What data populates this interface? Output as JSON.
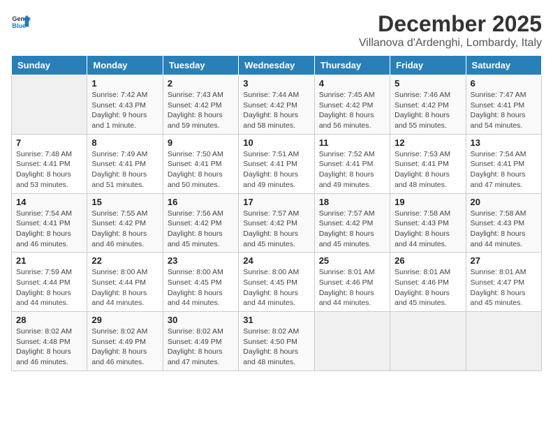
{
  "header": {
    "logo_line1": "General",
    "logo_line2": "Blue",
    "title": "December 2025",
    "subtitle": "Villanova d'Ardenghi, Lombardy, Italy"
  },
  "days_of_week": [
    "Sunday",
    "Monday",
    "Tuesday",
    "Wednesday",
    "Thursday",
    "Friday",
    "Saturday"
  ],
  "weeks": [
    [
      {
        "day": "",
        "info": ""
      },
      {
        "day": "1",
        "info": "Sunrise: 7:42 AM\nSunset: 4:43 PM\nDaylight: 9 hours\nand 1 minute."
      },
      {
        "day": "2",
        "info": "Sunrise: 7:43 AM\nSunset: 4:42 PM\nDaylight: 8 hours\nand 59 minutes."
      },
      {
        "day": "3",
        "info": "Sunrise: 7:44 AM\nSunset: 4:42 PM\nDaylight: 8 hours\nand 58 minutes."
      },
      {
        "day": "4",
        "info": "Sunrise: 7:45 AM\nSunset: 4:42 PM\nDaylight: 8 hours\nand 56 minutes."
      },
      {
        "day": "5",
        "info": "Sunrise: 7:46 AM\nSunset: 4:42 PM\nDaylight: 8 hours\nand 55 minutes."
      },
      {
        "day": "6",
        "info": "Sunrise: 7:47 AM\nSunset: 4:41 PM\nDaylight: 8 hours\nand 54 minutes."
      }
    ],
    [
      {
        "day": "7",
        "info": "Sunrise: 7:48 AM\nSunset: 4:41 PM\nDaylight: 8 hours\nand 53 minutes."
      },
      {
        "day": "8",
        "info": "Sunrise: 7:49 AM\nSunset: 4:41 PM\nDaylight: 8 hours\nand 51 minutes."
      },
      {
        "day": "9",
        "info": "Sunrise: 7:50 AM\nSunset: 4:41 PM\nDaylight: 8 hours\nand 50 minutes."
      },
      {
        "day": "10",
        "info": "Sunrise: 7:51 AM\nSunset: 4:41 PM\nDaylight: 8 hours\nand 49 minutes."
      },
      {
        "day": "11",
        "info": "Sunrise: 7:52 AM\nSunset: 4:41 PM\nDaylight: 8 hours\nand 49 minutes."
      },
      {
        "day": "12",
        "info": "Sunrise: 7:53 AM\nSunset: 4:41 PM\nDaylight: 8 hours\nand 48 minutes."
      },
      {
        "day": "13",
        "info": "Sunrise: 7:54 AM\nSunset: 4:41 PM\nDaylight: 8 hours\nand 47 minutes."
      }
    ],
    [
      {
        "day": "14",
        "info": "Sunrise: 7:54 AM\nSunset: 4:41 PM\nDaylight: 8 hours\nand 46 minutes."
      },
      {
        "day": "15",
        "info": "Sunrise: 7:55 AM\nSunset: 4:42 PM\nDaylight: 8 hours\nand 46 minutes."
      },
      {
        "day": "16",
        "info": "Sunrise: 7:56 AM\nSunset: 4:42 PM\nDaylight: 8 hours\nand 45 minutes."
      },
      {
        "day": "17",
        "info": "Sunrise: 7:57 AM\nSunset: 4:42 PM\nDaylight: 8 hours\nand 45 minutes."
      },
      {
        "day": "18",
        "info": "Sunrise: 7:57 AM\nSunset: 4:42 PM\nDaylight: 8 hours\nand 45 minutes."
      },
      {
        "day": "19",
        "info": "Sunrise: 7:58 AM\nSunset: 4:43 PM\nDaylight: 8 hours\nand 44 minutes."
      },
      {
        "day": "20",
        "info": "Sunrise: 7:58 AM\nSunset: 4:43 PM\nDaylight: 8 hours\nand 44 minutes."
      }
    ],
    [
      {
        "day": "21",
        "info": "Sunrise: 7:59 AM\nSunset: 4:44 PM\nDaylight: 8 hours\nand 44 minutes."
      },
      {
        "day": "22",
        "info": "Sunrise: 8:00 AM\nSunset: 4:44 PM\nDaylight: 8 hours\nand 44 minutes."
      },
      {
        "day": "23",
        "info": "Sunrise: 8:00 AM\nSunset: 4:45 PM\nDaylight: 8 hours\nand 44 minutes."
      },
      {
        "day": "24",
        "info": "Sunrise: 8:00 AM\nSunset: 4:45 PM\nDaylight: 8 hours\nand 44 minutes."
      },
      {
        "day": "25",
        "info": "Sunrise: 8:01 AM\nSunset: 4:46 PM\nDaylight: 8 hours\nand 44 minutes."
      },
      {
        "day": "26",
        "info": "Sunrise: 8:01 AM\nSunset: 4:46 PM\nDaylight: 8 hours\nand 45 minutes."
      },
      {
        "day": "27",
        "info": "Sunrise: 8:01 AM\nSunset: 4:47 PM\nDaylight: 8 hours\nand 45 minutes."
      }
    ],
    [
      {
        "day": "28",
        "info": "Sunrise: 8:02 AM\nSunset: 4:48 PM\nDaylight: 8 hours\nand 46 minutes."
      },
      {
        "day": "29",
        "info": "Sunrise: 8:02 AM\nSunset: 4:49 PM\nDaylight: 8 hours\nand 46 minutes."
      },
      {
        "day": "30",
        "info": "Sunrise: 8:02 AM\nSunset: 4:49 PM\nDaylight: 8 hours\nand 47 minutes."
      },
      {
        "day": "31",
        "info": "Sunrise: 8:02 AM\nSunset: 4:50 PM\nDaylight: 8 hours\nand 48 minutes."
      },
      {
        "day": "",
        "info": ""
      },
      {
        "day": "",
        "info": ""
      },
      {
        "day": "",
        "info": ""
      }
    ]
  ]
}
